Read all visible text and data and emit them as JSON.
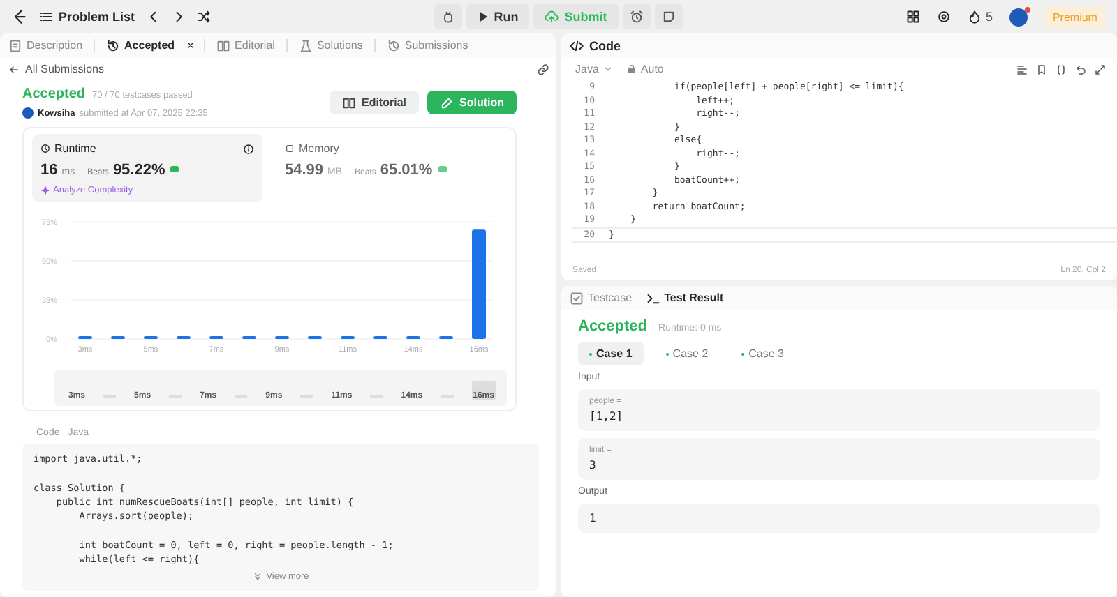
{
  "top_bar": {
    "problem_list": "Problem List",
    "run": "Run",
    "submit": "Submit",
    "streak": "5",
    "premium": "Premium"
  },
  "tabs": [
    {
      "label": "Description",
      "selected": false,
      "closable": false
    },
    {
      "label": "Accepted",
      "selected": true,
      "closable": true
    },
    {
      "label": "Editorial",
      "selected": false,
      "closable": false
    },
    {
      "label": "Solutions",
      "selected": false,
      "closable": false
    },
    {
      "label": "Submissions",
      "selected": false,
      "closable": false
    }
  ],
  "back_link": "All Submissions",
  "submission": {
    "status": "Accepted",
    "testcases": "70 / 70 testcases passed",
    "author": "Kowsiha",
    "submitted": "submitted at Apr 07, 2025 22:35",
    "editorial": "Editorial",
    "solution": "Solution"
  },
  "stats": [
    {
      "kind": "runtime",
      "label": "Runtime",
      "value": "16",
      "unit": "ms",
      "beats_label": "Beats",
      "beats": "95.22%",
      "selected": true,
      "analyze": "Analyze Complexity"
    },
    {
      "kind": "memory",
      "label": "Memory",
      "value": "54.99",
      "unit": "MB",
      "beats_label": "Beats",
      "beats": "65.01%",
      "selected": false
    }
  ],
  "chart_data": {
    "type": "bar",
    "categories": [
      "3ms",
      null,
      "5ms",
      null,
      "7ms",
      null,
      "9ms",
      null,
      "11ms",
      null,
      "14ms",
      null,
      "16ms"
    ],
    "values": [
      1,
      1,
      1,
      1,
      1,
      1,
      1,
      1,
      1,
      1,
      1,
      1,
      70
    ],
    "ylim": [
      0,
      75
    ],
    "yticks": [
      {
        "value": 0,
        "label": "0%"
      },
      {
        "value": 25,
        "label": "25%"
      },
      {
        "value": 50,
        "label": "50%"
      },
      {
        "value": 75,
        "label": "75%"
      }
    ]
  },
  "range_labels": [
    {
      "label": "3ms",
      "selected": false
    },
    {
      "label": "5ms",
      "selected": false
    },
    {
      "label": "7ms",
      "selected": false
    },
    {
      "label": "9ms",
      "selected": false
    },
    {
      "label": "11ms",
      "selected": false
    },
    {
      "label": "14ms",
      "selected": false
    },
    {
      "label": "16ms",
      "selected": true
    }
  ],
  "code_section": {
    "label": "Code",
    "language": "Java",
    "view_more": "View more",
    "lines": [
      {
        "text": "import java.util.*;",
        "blank_before": false
      },
      {
        "text": "class Solution {",
        "blank_before": true
      },
      {
        "text": "    public int numRescueBoats(int[] people, int limit) {",
        "blank_before": false
      },
      {
        "text": "        Arrays.sort(people);",
        "blank_before": false
      },
      {
        "text": "        int boatCount = 0, left = 0, right = people.length - 1;",
        "blank_before": true
      },
      {
        "text": "        while(left <= right){",
        "blank_before": false
      }
    ]
  },
  "editor": {
    "title": "Code",
    "language": "Java",
    "mode": "Auto",
    "status": "Saved",
    "cursor": "Ln 20, Col 2",
    "lines": [
      {
        "n": "9",
        "text": "            if(people[left] + people[right] <= limit){"
      },
      {
        "n": "10",
        "text": "                left++;"
      },
      {
        "n": "11",
        "text": "                right--;"
      },
      {
        "n": "12",
        "text": "            }"
      },
      {
        "n": "13",
        "text": "            else{"
      },
      {
        "n": "14",
        "text": "                right--;"
      },
      {
        "n": "15",
        "text": "            }"
      },
      {
        "n": "16",
        "text": "            boatCount++;"
      },
      {
        "n": "17",
        "text": "        }"
      },
      {
        "n": "18",
        "text": "        return boatCount;"
      },
      {
        "n": "19",
        "text": "    }"
      },
      {
        "n": "20",
        "text": "}"
      }
    ]
  },
  "test_panel": {
    "tabs": [
      {
        "label": "Testcase",
        "selected": false
      },
      {
        "label": "Test Result",
        "selected": true
      }
    ],
    "status": "Accepted",
    "runtime": "Runtime: 0 ms",
    "cases": [
      {
        "label": "Case 1",
        "selected": true
      },
      {
        "label": "Case 2",
        "selected": false
      },
      {
        "label": "Case 3",
        "selected": false
      }
    ],
    "input_label": "Input",
    "inputs": [
      {
        "name": "people =",
        "value": "[1,2]"
      },
      {
        "name": "limit =",
        "value": "3"
      }
    ],
    "output_label": "Output",
    "output": "1"
  }
}
